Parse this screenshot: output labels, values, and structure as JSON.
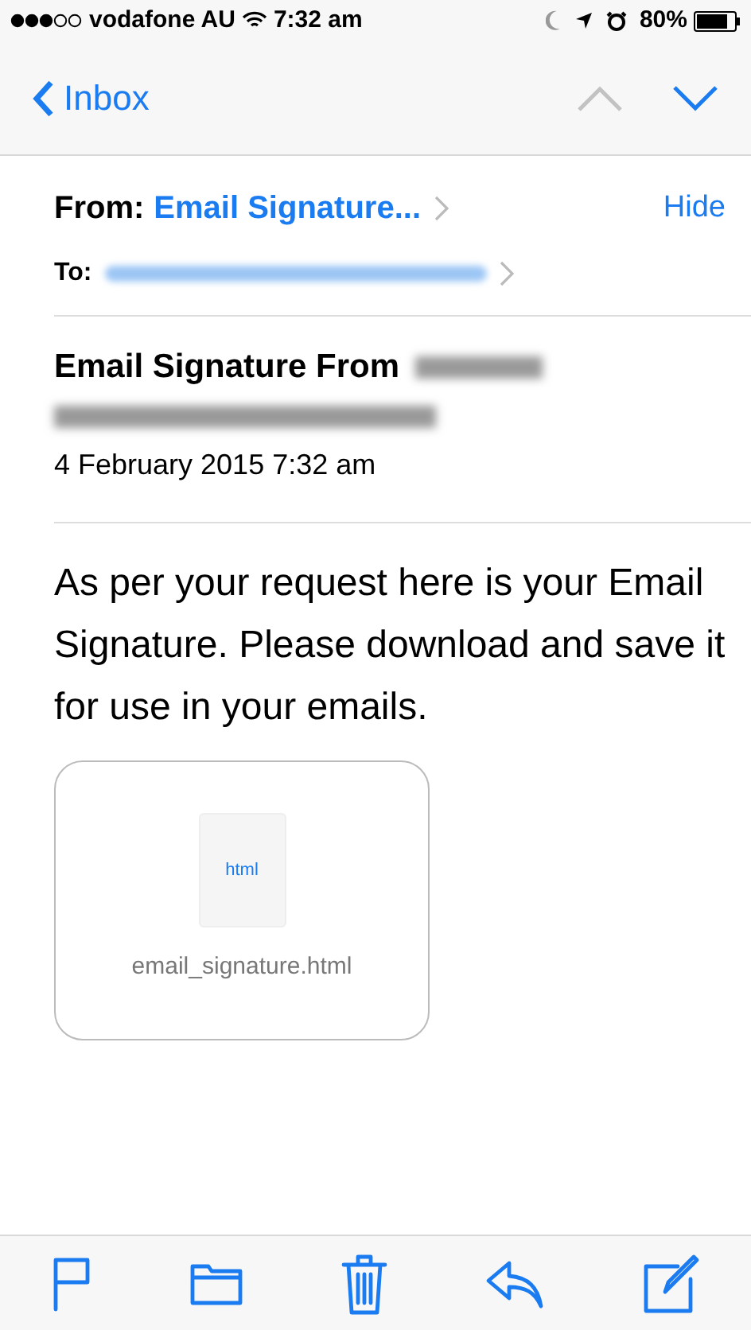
{
  "status_bar": {
    "carrier": "vodafone AU",
    "time": "7:32 am",
    "battery": "80%"
  },
  "nav": {
    "back": "Inbox",
    "previous_disabled": true,
    "next_disabled": false
  },
  "header": {
    "from_label": "From:",
    "from_name": "Email Signature...",
    "hide": "Hide",
    "to_label": "To:"
  },
  "subject": {
    "text": "Email Signature From",
    "date": "4 February 2015 7:32 am"
  },
  "body": "As per your request here is your Email Signature. Please download and save it for use in your emails.",
  "attachment": {
    "type": "html",
    "filename": "email_signature.html"
  },
  "toolbar": [
    {
      "kind": "flag"
    },
    {
      "kind": "folder"
    },
    {
      "kind": "trash"
    },
    {
      "kind": "reply"
    },
    {
      "kind": "compose"
    }
  ]
}
